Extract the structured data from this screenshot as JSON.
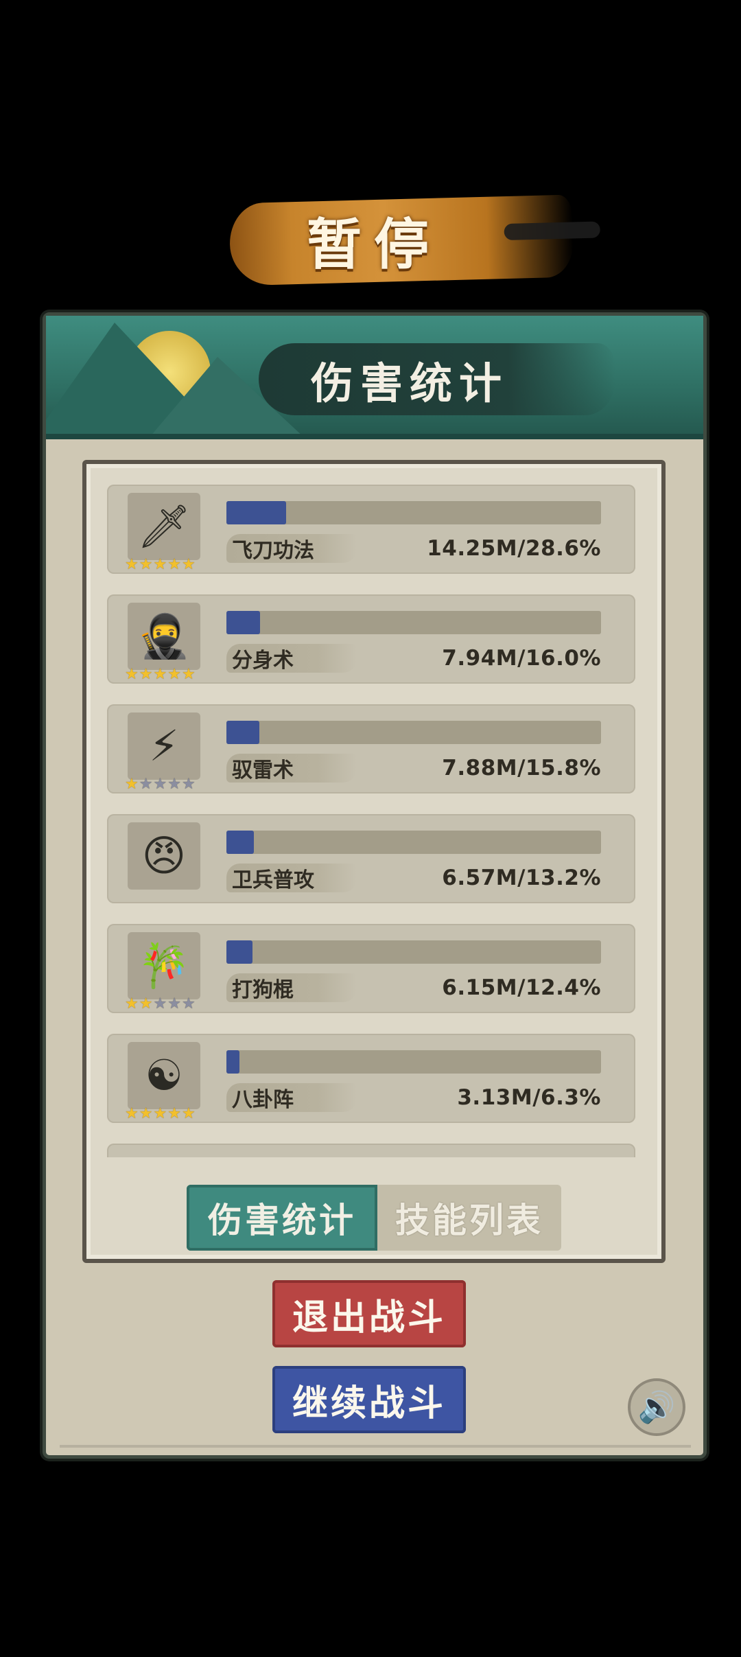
{
  "title": "暂停",
  "dialog": {
    "header_title": "伤害统计"
  },
  "skills": [
    {
      "name": "飞刀功法",
      "value": "14.25M/28.6%",
      "fraction": 0.286,
      "icon": "flying-daggers-icon",
      "glyph": "🗡",
      "stars": [
        1,
        1,
        1,
        1,
        1
      ]
    },
    {
      "name": "分身术",
      "value": "7.94M/16.0%",
      "fraction": 0.16,
      "icon": "clone-warriors-icon",
      "glyph": "🥷",
      "stars": [
        1,
        1,
        1,
        1,
        1
      ]
    },
    {
      "name": "驭雷术",
      "value": "7.88M/15.8%",
      "fraction": 0.158,
      "icon": "lightning-orb-icon",
      "glyph": "⚡",
      "stars": [
        1,
        0,
        0,
        0,
        0
      ]
    },
    {
      "name": "卫兵普攻",
      "value": "6.57M/13.2%",
      "fraction": 0.132,
      "icon": "guard-face-icon",
      "glyph": "😠",
      "stars": []
    },
    {
      "name": "打狗棍",
      "value": "6.15M/12.4%",
      "fraction": 0.124,
      "icon": "bamboo-staff-icon",
      "glyph": "🎋",
      "stars": [
        1,
        1,
        0,
        0,
        0
      ]
    },
    {
      "name": "八卦阵",
      "value": "3.13M/6.3%",
      "fraction": 0.063,
      "icon": "bagua-icon",
      "glyph": "☯",
      "stars": [
        1,
        1,
        1,
        1,
        1
      ]
    }
  ],
  "tabs": {
    "damage_stats": "伤害统计",
    "skill_list": "技能列表"
  },
  "buttons": {
    "exit_battle": "退出战斗",
    "continue_battle": "继续战斗"
  },
  "icons": {
    "sound": "speaker-icon"
  },
  "colors": {
    "bar_fill": "#3d5293",
    "exit_button": "#b84543",
    "continue_button": "#3e55a3",
    "active_tab": "#3f8a7f"
  }
}
